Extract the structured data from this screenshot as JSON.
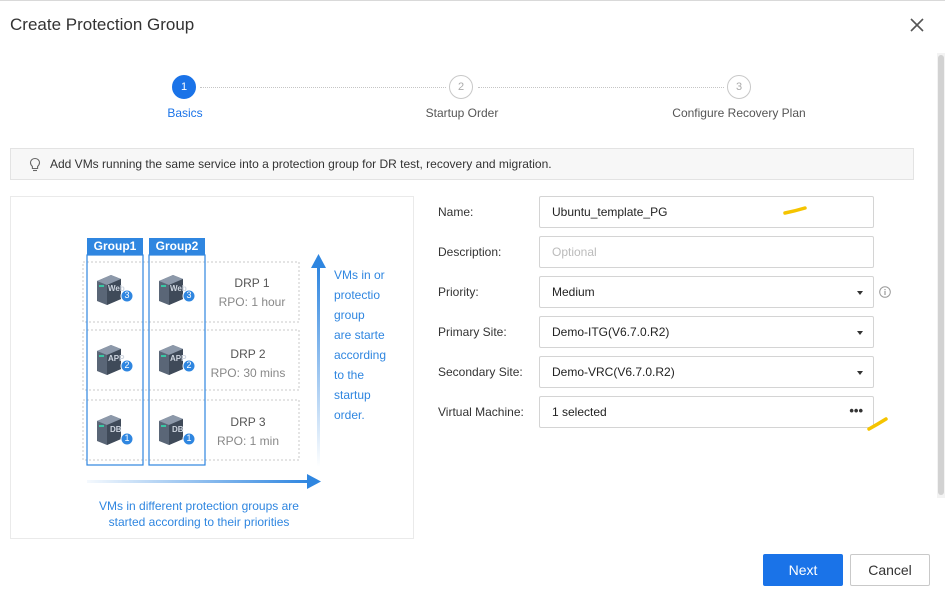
{
  "dialog": {
    "title": "Create Protection Group"
  },
  "steps": [
    {
      "number": "1",
      "label": "Basics",
      "state": "active"
    },
    {
      "number": "2",
      "label": "Startup Order",
      "state": "inactive"
    },
    {
      "number": "3",
      "label": "Configure Recovery Plan",
      "state": "inactive"
    }
  ],
  "tip": {
    "icon": "lightbulb-icon",
    "text": "Add VMs running the same service into a protection group for DR test, recovery and migration."
  },
  "illustration": {
    "groups": [
      "Group1",
      "Group2"
    ],
    "rows": [
      {
        "drp": "DRP 1",
        "rpo": "RPO: 1 hour",
        "vm_label": "Web",
        "count": "3"
      },
      {
        "drp": "DRP 2",
        "rpo": "RPO: 30 mins",
        "vm_label": "APP",
        "count": "2"
      },
      {
        "drp": "DRP 3",
        "rpo": "RPO: 1 min",
        "vm_label": "DB",
        "count": "1"
      }
    ],
    "vertical_caption": [
      "VMs in or",
      "protectio",
      "group",
      "are starte",
      "according",
      "to the",
      "startup",
      "order."
    ],
    "bottom_caption": [
      "VMs in different protection groups are",
      "started according to their priorities"
    ]
  },
  "form": {
    "name": {
      "label": "Name:",
      "value": "Ubuntu_template_PG"
    },
    "description": {
      "label": "Description:",
      "placeholder": "Optional"
    },
    "priority": {
      "label": "Priority:",
      "value": "Medium"
    },
    "primary_site": {
      "label": "Primary Site:",
      "value": "Demo-ITG(V6.7.0.R2)"
    },
    "secondary_site": {
      "label": "Secondary Site:",
      "value": "Demo-VRC(V6.7.0.R2)"
    },
    "virtual_machine": {
      "label": "Virtual Machine:",
      "value": "1 selected",
      "more": "•••"
    }
  },
  "buttons": {
    "next": "Next",
    "cancel": "Cancel"
  },
  "colors": {
    "accent": "#1a73e8",
    "illustration_blue": "#2f86e0",
    "annotation_yellow": "#f5c400"
  }
}
